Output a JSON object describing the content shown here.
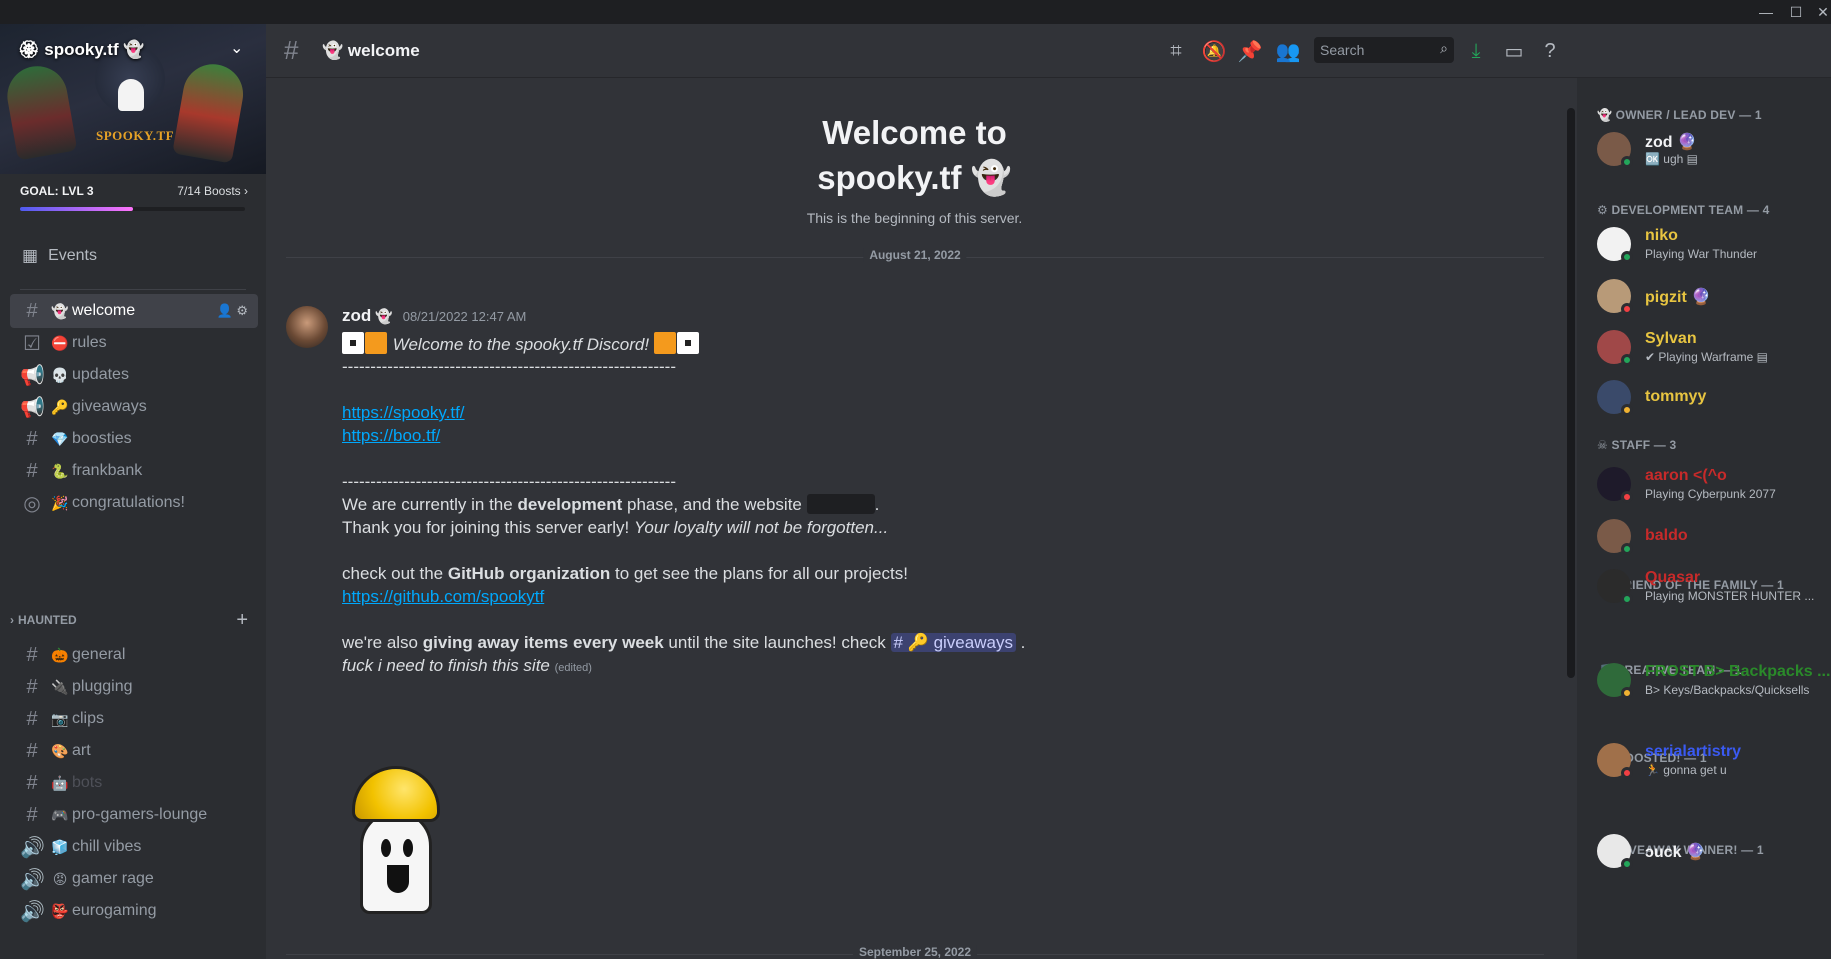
{
  "window": {
    "minimize": "—",
    "maximize": "☐",
    "close": "✕"
  },
  "server": {
    "name": "🏵 spooky.tf 👻",
    "banner_logo": "SPOOKY.TF",
    "goal": "GOAL: LVL 3",
    "boosts": "7/14 Boosts ›",
    "boost_progress": 0.5
  },
  "sidebar": {
    "events": "Events",
    "category": "HAUNTED",
    "channels_top": [
      {
        "icon": "#",
        "emoji": "👻",
        "label": "welcome"
      },
      {
        "icon": "☑",
        "emoji": "⛔",
        "label": "rules"
      },
      {
        "icon": "📢",
        "emoji": "💀",
        "label": "updates"
      },
      {
        "icon": "📢",
        "emoji": "🔑",
        "label": "giveaways"
      },
      {
        "icon": "#",
        "emoji": "💎",
        "label": "boosties"
      },
      {
        "icon": "#",
        "emoji": "🐍",
        "label": "frankbank"
      },
      {
        "icon": "◎",
        "emoji": "🎉",
        "label": "congratulations!"
      }
    ],
    "channels_haunted": [
      {
        "icon": "#",
        "emoji": "🎃",
        "label": "general"
      },
      {
        "icon": "#",
        "emoji": "🔌",
        "label": "plugging"
      },
      {
        "icon": "#",
        "emoji": "📷",
        "label": "clips"
      },
      {
        "icon": "#",
        "emoji": "🎨",
        "label": "art"
      },
      {
        "icon": "#",
        "emoji": "🤖",
        "label": "bots"
      },
      {
        "icon": "#",
        "emoji": "🎮",
        "label": "pro-gamers-lounge"
      },
      {
        "icon": "🔊",
        "emoji": "🧊",
        "label": "chill vibes"
      },
      {
        "icon": "🔊",
        "emoji": "😡",
        "label": "gamer rage"
      },
      {
        "icon": "🔊",
        "emoji": "👺",
        "label": "eurogaming"
      }
    ]
  },
  "header": {
    "channel": "👻 welcome",
    "search_placeholder": "Search"
  },
  "welcome": {
    "title_line1": "Welcome to",
    "title_line2": "spooky.tf 👻",
    "subtitle": "This is the beginning of this server.",
    "date1": "August 21, 2022",
    "date2": "September 25, 2022"
  },
  "message": {
    "author": "zod",
    "author_badge": "👻",
    "timestamp": "08/21/2022 12:47 AM",
    "welcome_line": "Welcome to the spooky.tf Discord!",
    "rule": "-----------------------------------------------------------",
    "link1": "https://spooky.tf/",
    "link2": "https://boo.tf/",
    "dev_pre": "We are currently in  the ",
    "dev_bold": "development",
    "dev_post": " phase, and the website ",
    "dev_end": ".",
    "thanks": "Thank you for joining this server early! ",
    "thanks_italic": "Your loyalty will not be forgotten...",
    "gh_pre": "check out the ",
    "gh_bold": "GitHub organization",
    "gh_post": " to get see the plans for all our projects!",
    "gh_link": "https://github.com/spookytf",
    "give_pre": "we're also ",
    "give_bold": "giving away items every week",
    "give_post": " until the site launches! check ",
    "give_mention": "# 🔑 giveaways",
    "give_end": " .",
    "last_italic": "fuck i need to finish this site",
    "edited": "(edited)"
  },
  "members": {
    "roles": [
      {
        "label": "👻 OWNER / LEAD DEV — 1"
      },
      {
        "label": "⚙ DEVELOPMENT TEAM — 4"
      },
      {
        "label": "☠ STAFF — 3"
      },
      {
        "label": "🍐 FRIEND OF THE FAMILY — 1"
      },
      {
        "label": "🎵 CREATIVE TEAM — 1"
      },
      {
        "label": "🔮 BOOSTED! — 1"
      },
      {
        "label": "💎 GIVEAWAY WINNER! — 1"
      }
    ],
    "list": [
      {
        "name": "zod 🔮",
        "sub": "🆗 ugh ▤",
        "color": "#f2f3f5",
        "status": "online",
        "avatar": "#7a5a48"
      },
      {
        "name": "niko",
        "sub": "Playing War Thunder",
        "color": "#e8c541",
        "status": "online",
        "avatar": "#f2f2f2"
      },
      {
        "name": "pigzit 🔮",
        "sub": "",
        "color": "#e8c541",
        "status": "dnd",
        "avatar": "#b89a78"
      },
      {
        "name": "Sylvan",
        "sub": "✔ Playing Warframe ▤",
        "color": "#e8c541",
        "status": "online",
        "avatar": "#a04848"
      },
      {
        "name": "tommyy",
        "sub": "",
        "color": "#e8c541",
        "status": "idle",
        "avatar": "#3a4a6a"
      },
      {
        "name": "aaron <(^o",
        "sub": "Playing Cyberpunk 2077",
        "color": "#c72a2a",
        "status": "dnd",
        "avatar": "#1e1a2a"
      },
      {
        "name": "baldo",
        "sub": "",
        "color": "#c72a2a",
        "status": "online",
        "avatar": "#7a5a48"
      },
      {
        "name": "Quasar",
        "sub": "Playing MONSTER HUNTER ...",
        "color": "#c72a2a",
        "status": "online",
        "avatar": "#2b2b2b"
      },
      {
        "name": "FROST B> Backpacks ...",
        "sub": "B> Keys/Backpacks/Quicksells",
        "color": "#2a8a2a",
        "status": "idle",
        "avatar": "#2f6a3a"
      },
      {
        "name": "serialartistry",
        "sub": "🏃 gonna get u",
        "color": "#3a5af2",
        "status": "dnd",
        "avatar": "#a0704a"
      },
      {
        "name": "ɔuck 🔮",
        "sub": "",
        "color": "#f2f3f5",
        "status": "online",
        "avatar": "#e8e8e8"
      }
    ]
  },
  "colors": {
    "accent": "#5865f2",
    "link": "#00a8fc",
    "online": "#23a55a",
    "dnd": "#f23f43",
    "idle": "#f0b232",
    "download": "#23a55a"
  },
  "icons": [
    "threads-icon",
    "mute-icon",
    "pin-icon",
    "members-icon",
    "search-icon",
    "download-icon",
    "inbox-icon",
    "help-icon"
  ]
}
